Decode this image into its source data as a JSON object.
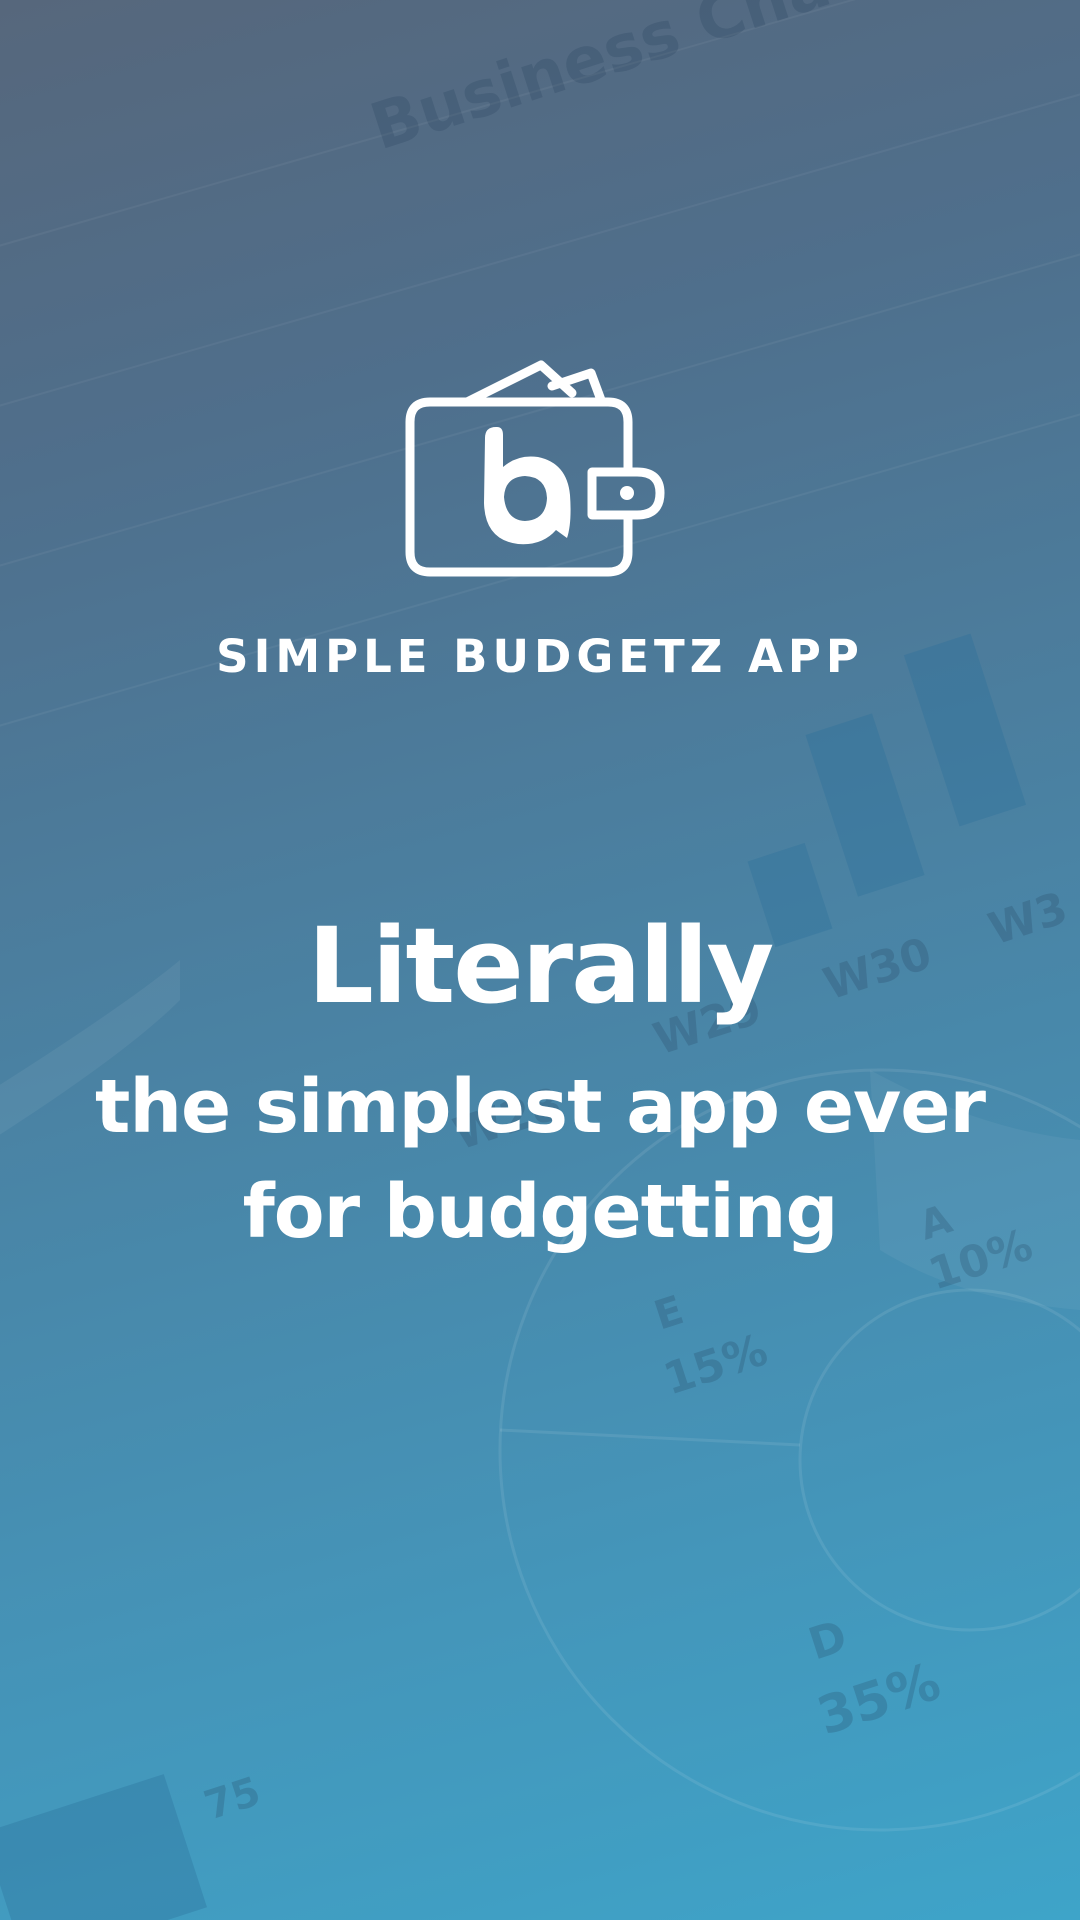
{
  "background": {
    "title_text": "Business Cha",
    "week_labels": [
      "W28",
      "W29",
      "W30",
      "W3"
    ],
    "pie_labels": [
      {
        "letter": "A",
        "percent": "10%"
      },
      {
        "letter": "E",
        "percent": "15%"
      },
      {
        "letter": "D",
        "percent": "35%"
      }
    ],
    "axis_value": "75"
  },
  "splash": {
    "logo_icon": "wallet-logo-icon",
    "app_name": "SIMPLE BUDGETZ APP",
    "headline": "Literally",
    "tagline_line1": "the simplest app ever",
    "tagline_line2": "for budgetting"
  },
  "colors": {
    "gradient_top": "#56677c",
    "gradient_bottom": "#3ea4c9",
    "text": "#ffffff"
  }
}
